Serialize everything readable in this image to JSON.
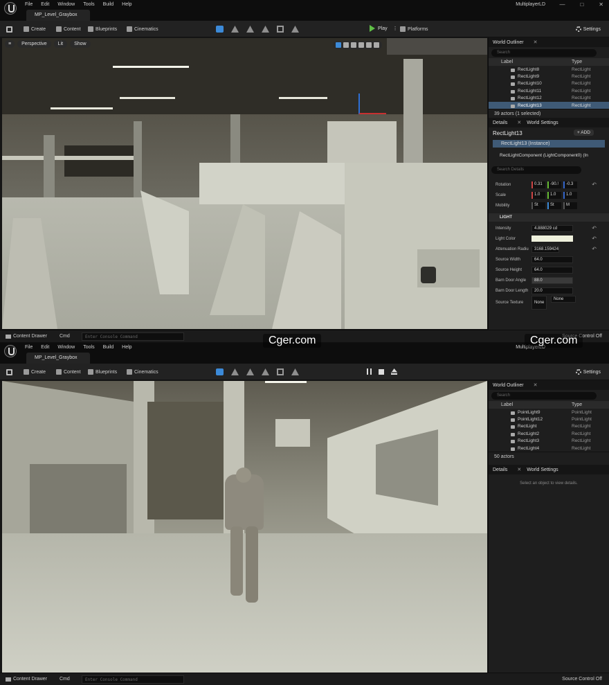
{
  "app": {
    "menu": [
      "File",
      "Edit",
      "Window",
      "Tools",
      "Build",
      "Help"
    ],
    "project_title": "MultiplayerLD",
    "level_tab": "MP_Level_Graybox",
    "window_buttons": [
      "—",
      "□",
      "✕"
    ]
  },
  "toolbar": {
    "create": "Create",
    "content": "Content",
    "blueprints": "Blueprints",
    "cinematics": "Cinematics",
    "play": "Play",
    "platforms": "Platforms",
    "settings": "Settings"
  },
  "viewport": {
    "perspective": "Perspective",
    "lit": "Lit",
    "show": "Show"
  },
  "bottom": {
    "content_drawer": "Content Drawer",
    "cmd": "Cmd",
    "console_placeholder": "Enter Console Command",
    "source_control": "Source Control Off"
  },
  "outliner": {
    "tab": "World Outliner",
    "search_placeholder": "Search",
    "col_label": "Label",
    "col_type": "Type"
  },
  "top_editor": {
    "rows": [
      {
        "label": "RectLight8",
        "type": "RectLight"
      },
      {
        "label": "RectLight9",
        "type": "RectLight"
      },
      {
        "label": "RectLight10",
        "type": "RectLight"
      },
      {
        "label": "RectLight11",
        "type": "RectLight"
      },
      {
        "label": "RectLight12",
        "type": "RectLight"
      },
      {
        "label": "RectLight13",
        "type": "RectLight"
      }
    ],
    "count": "39 actors (1 selected)",
    "details_tab": "Details",
    "world_settings_tab": "World Settings",
    "actor_name": "RectLight13",
    "add_label": "+ ADD",
    "instance_row": "RectLight13 (Instance)",
    "component_row": "RectLightComponent (LightComponent0) (In",
    "details_search": "Search Details",
    "rotation": {
      "label": "Rotation",
      "x": "0.31",
      "y": "-90.!",
      "z": "-0.3"
    },
    "scale": {
      "label": "Scale",
      "x": "1.0",
      "y": "1.0",
      "z": "1.0"
    },
    "mobility_label": "Mobility",
    "mobility": [
      "St",
      "St",
      "M"
    ],
    "light_section": "LIGHT",
    "props": [
      {
        "label": "Intensity",
        "value": "4.888029 cd"
      },
      {
        "label": "Light Color",
        "value": ""
      },
      {
        "label": "Attenuation Radiu",
        "value": "3168.159424"
      },
      {
        "label": "Source Width",
        "value": "64.0"
      },
      {
        "label": "Source Height",
        "value": "64.0"
      },
      {
        "label": "Barn Door Angle",
        "value": "88.0"
      },
      {
        "label": "Barn Door Length",
        "value": "20.0"
      },
      {
        "label": "Source Texture",
        "value": "None"
      }
    ],
    "texture_thumb": "None",
    "texture_dropdown": "None",
    "light_color": "#eef0dc"
  },
  "bottom_editor": {
    "rows": [
      {
        "label": "PointLight9",
        "type": "PointLight"
      },
      {
        "label": "PointLight12",
        "type": "PointLight"
      },
      {
        "label": "RectLight",
        "type": "RectLight"
      },
      {
        "label": "RectLight2",
        "type": "RectLight"
      },
      {
        "label": "RectLight3",
        "type": "RectLight"
      },
      {
        "label": "RectLight4",
        "type": "RectLight"
      }
    ],
    "count": "50 actors",
    "details_tab": "Details",
    "world_settings_tab": "World Settings",
    "empty_details": "Select an object to view details."
  },
  "watermark": "Cger.com",
  "colors": {
    "accent_blue": "#3c8ad8",
    "play_green": "#5fbf46",
    "selection": "#3f5a76"
  }
}
